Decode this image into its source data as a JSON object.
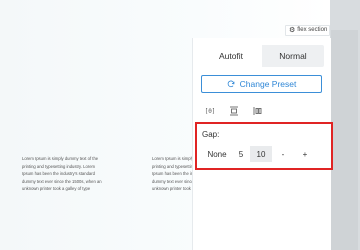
{
  "flex_tag": {
    "label": "flex section"
  },
  "content": {
    "columns": [
      "Lorem Ipsum is simply dummy text of the printing and typesetting industry. Lorem Ipsum has been the industry's standard dummy text ever since the 1500s, when an unknown printer took a galley of type",
      "Lorem Ipsum is simply dummy text of the printing and typesetting industry. Lorem Ipsum has been the industry's standard dummy text ever since the 1500s, when an unknown printer took a galley of type"
    ]
  },
  "panel": {
    "fit_toggle": {
      "options": [
        "Autofit",
        "Normal"
      ],
      "selected": "Normal"
    },
    "change_preset": {
      "label": "Change Preset",
      "accent": "#2e86d6"
    },
    "alignment_icons": [
      "align-horizontal-center-icon",
      "align-vertical-center-icon",
      "distribute-icon"
    ],
    "gap": {
      "label": "Gap:",
      "options": [
        "None",
        "5",
        "10"
      ],
      "selected": "10",
      "decrement": "-",
      "increment": "+"
    }
  },
  "highlight_color": "#e02424"
}
